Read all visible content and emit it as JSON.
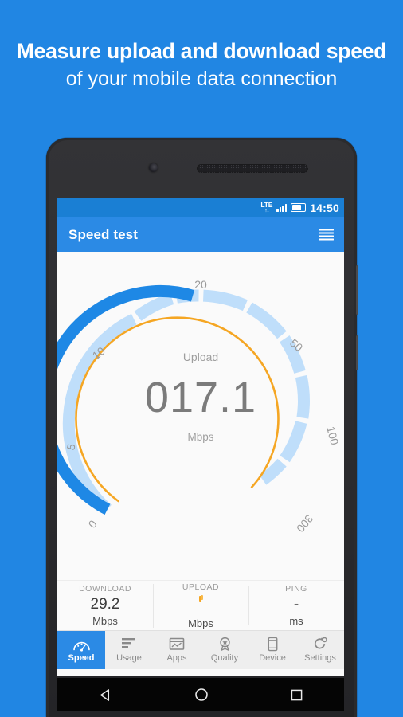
{
  "headline": {
    "line1": "Measure upload and download speed",
    "line2": "of your mobile data connection"
  },
  "colors": {
    "background": "#2186e3",
    "toolbar": "#2b8ae5",
    "statusbar": "#1a7fd4",
    "accent_blue": "#2b8ae5",
    "gauge_active": "#1e88e5",
    "gauge_track": "#bfdefa",
    "gauge_needle": "#f5a623",
    "screen_bg": "#fafafa"
  },
  "statusbar": {
    "network": "LTE",
    "network_arrows": "↑↓",
    "signal_icon": "signal-bars-icon",
    "battery_icon": "battery-icon",
    "time": "14:50"
  },
  "toolbar": {
    "title": "Speed test",
    "menu_icon": "hamburger-menu-icon"
  },
  "gauge": {
    "ticks": [
      "0",
      "5",
      "10",
      "20",
      "50",
      "100",
      "300"
    ],
    "center_label": "Upload",
    "center_value": "017.1",
    "center_unit": "Mbps",
    "active_value": 17.1,
    "max_value": 300
  },
  "stats": [
    {
      "caption": "DOWNLOAD",
      "value": "29.2",
      "unit": "Mbps",
      "loading": false
    },
    {
      "caption": "UPLOAD",
      "value": "",
      "unit": "Mbps",
      "loading": true
    },
    {
      "caption": "PING",
      "value": "-",
      "unit": "ms",
      "loading": false
    }
  ],
  "tabs": [
    {
      "label": "Speed",
      "icon": "speedometer-icon",
      "active": true
    },
    {
      "label": "Usage",
      "icon": "bar-list-icon",
      "active": false
    },
    {
      "label": "Apps",
      "icon": "apps-chart-icon",
      "active": false
    },
    {
      "label": "Quality",
      "icon": "award-star-icon",
      "active": false
    },
    {
      "label": "Device",
      "icon": "phone-icon",
      "active": false
    },
    {
      "label": "Settings",
      "icon": "gear-icon",
      "active": false
    }
  ],
  "android_nav": {
    "back": "back-triangle-icon",
    "home": "home-circle-icon",
    "recents": "recents-square-icon"
  }
}
